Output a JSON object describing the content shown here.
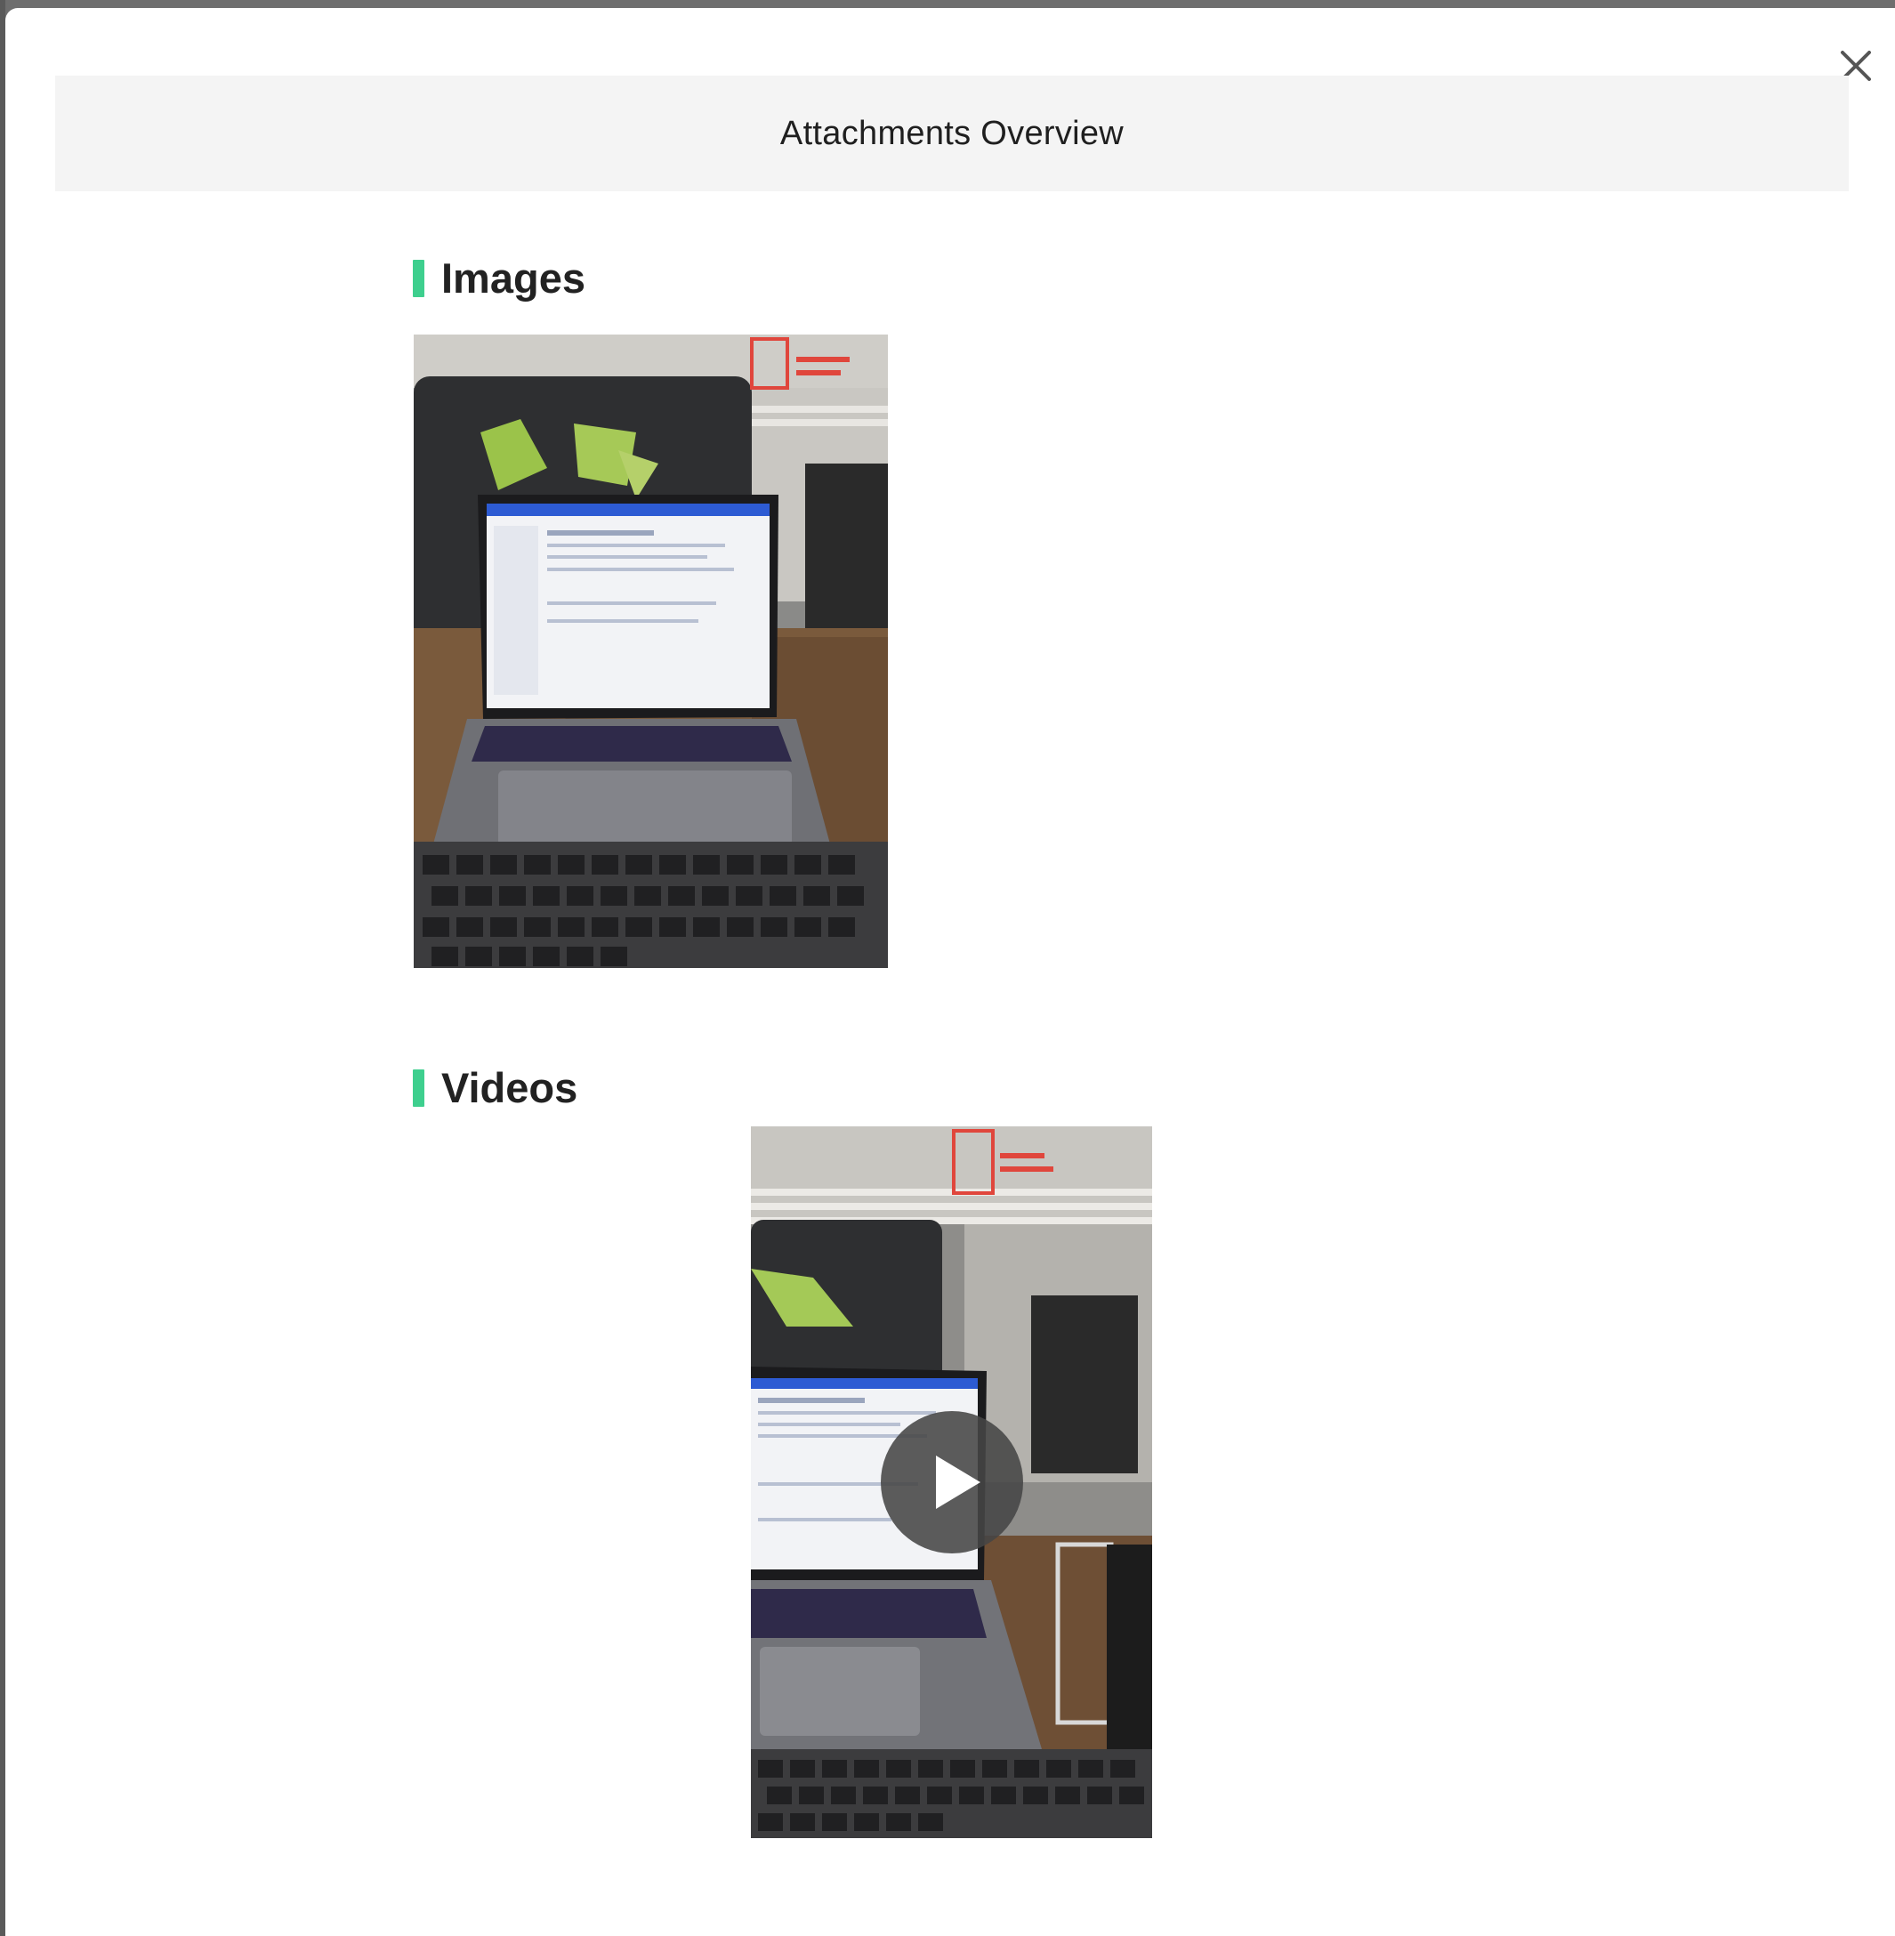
{
  "modal": {
    "title": "Attachments Overview",
    "close_icon": "close-icon"
  },
  "sections": {
    "images": {
      "title": "Images"
    },
    "videos": {
      "title": "Videos"
    }
  },
  "media": {
    "image_thumbnail_icon": "photo-thumbnail",
    "video_thumbnail_icon": "video-thumbnail",
    "play_icon": "play-icon"
  },
  "colors": {
    "accent": "#3ecf8e",
    "header_bg": "#f4f4f4"
  }
}
